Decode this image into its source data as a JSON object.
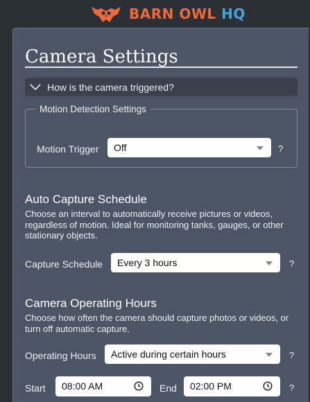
{
  "header": {
    "brand_part1": "BARN",
    "brand_part2": "OWL",
    "brand_part3": "HQ",
    "logo_icon": "owl-logo-icon",
    "colors": {
      "brand_orange": "#ef6a3a",
      "brand_blue": "#4aa3d8",
      "panel": "#4b5565",
      "background": "#2b2f36"
    }
  },
  "page": {
    "title": "Camera Settings"
  },
  "faq": {
    "label": "How is the camera triggered?",
    "icon": "chevron-down-icon"
  },
  "motion": {
    "legend": "Motion Detection Settings",
    "trigger_label": "Motion Trigger",
    "trigger_value": "Off",
    "help": "?"
  },
  "auto_capture": {
    "title": "Auto Capture Schedule",
    "description": "Choose an interval to automatically receive pictures or videos, regardless of motion. Ideal for monitoring tanks, gauges, or other stationary objects.",
    "schedule_label": "Capture Schedule",
    "schedule_value": "Every 3 hours",
    "help": "?"
  },
  "operating": {
    "title": "Camera Operating Hours",
    "description": "Choose how often the camera should capture photos or videos, or turn off automatic capture.",
    "hours_label": "Operating Hours",
    "hours_value": "Active during certain hours",
    "help": "?",
    "start_label": "Start",
    "start_value": "08:00 AM",
    "end_label": "End",
    "end_value": "02:00 PM",
    "time_help": "?",
    "time_icon": "clock-icon"
  }
}
